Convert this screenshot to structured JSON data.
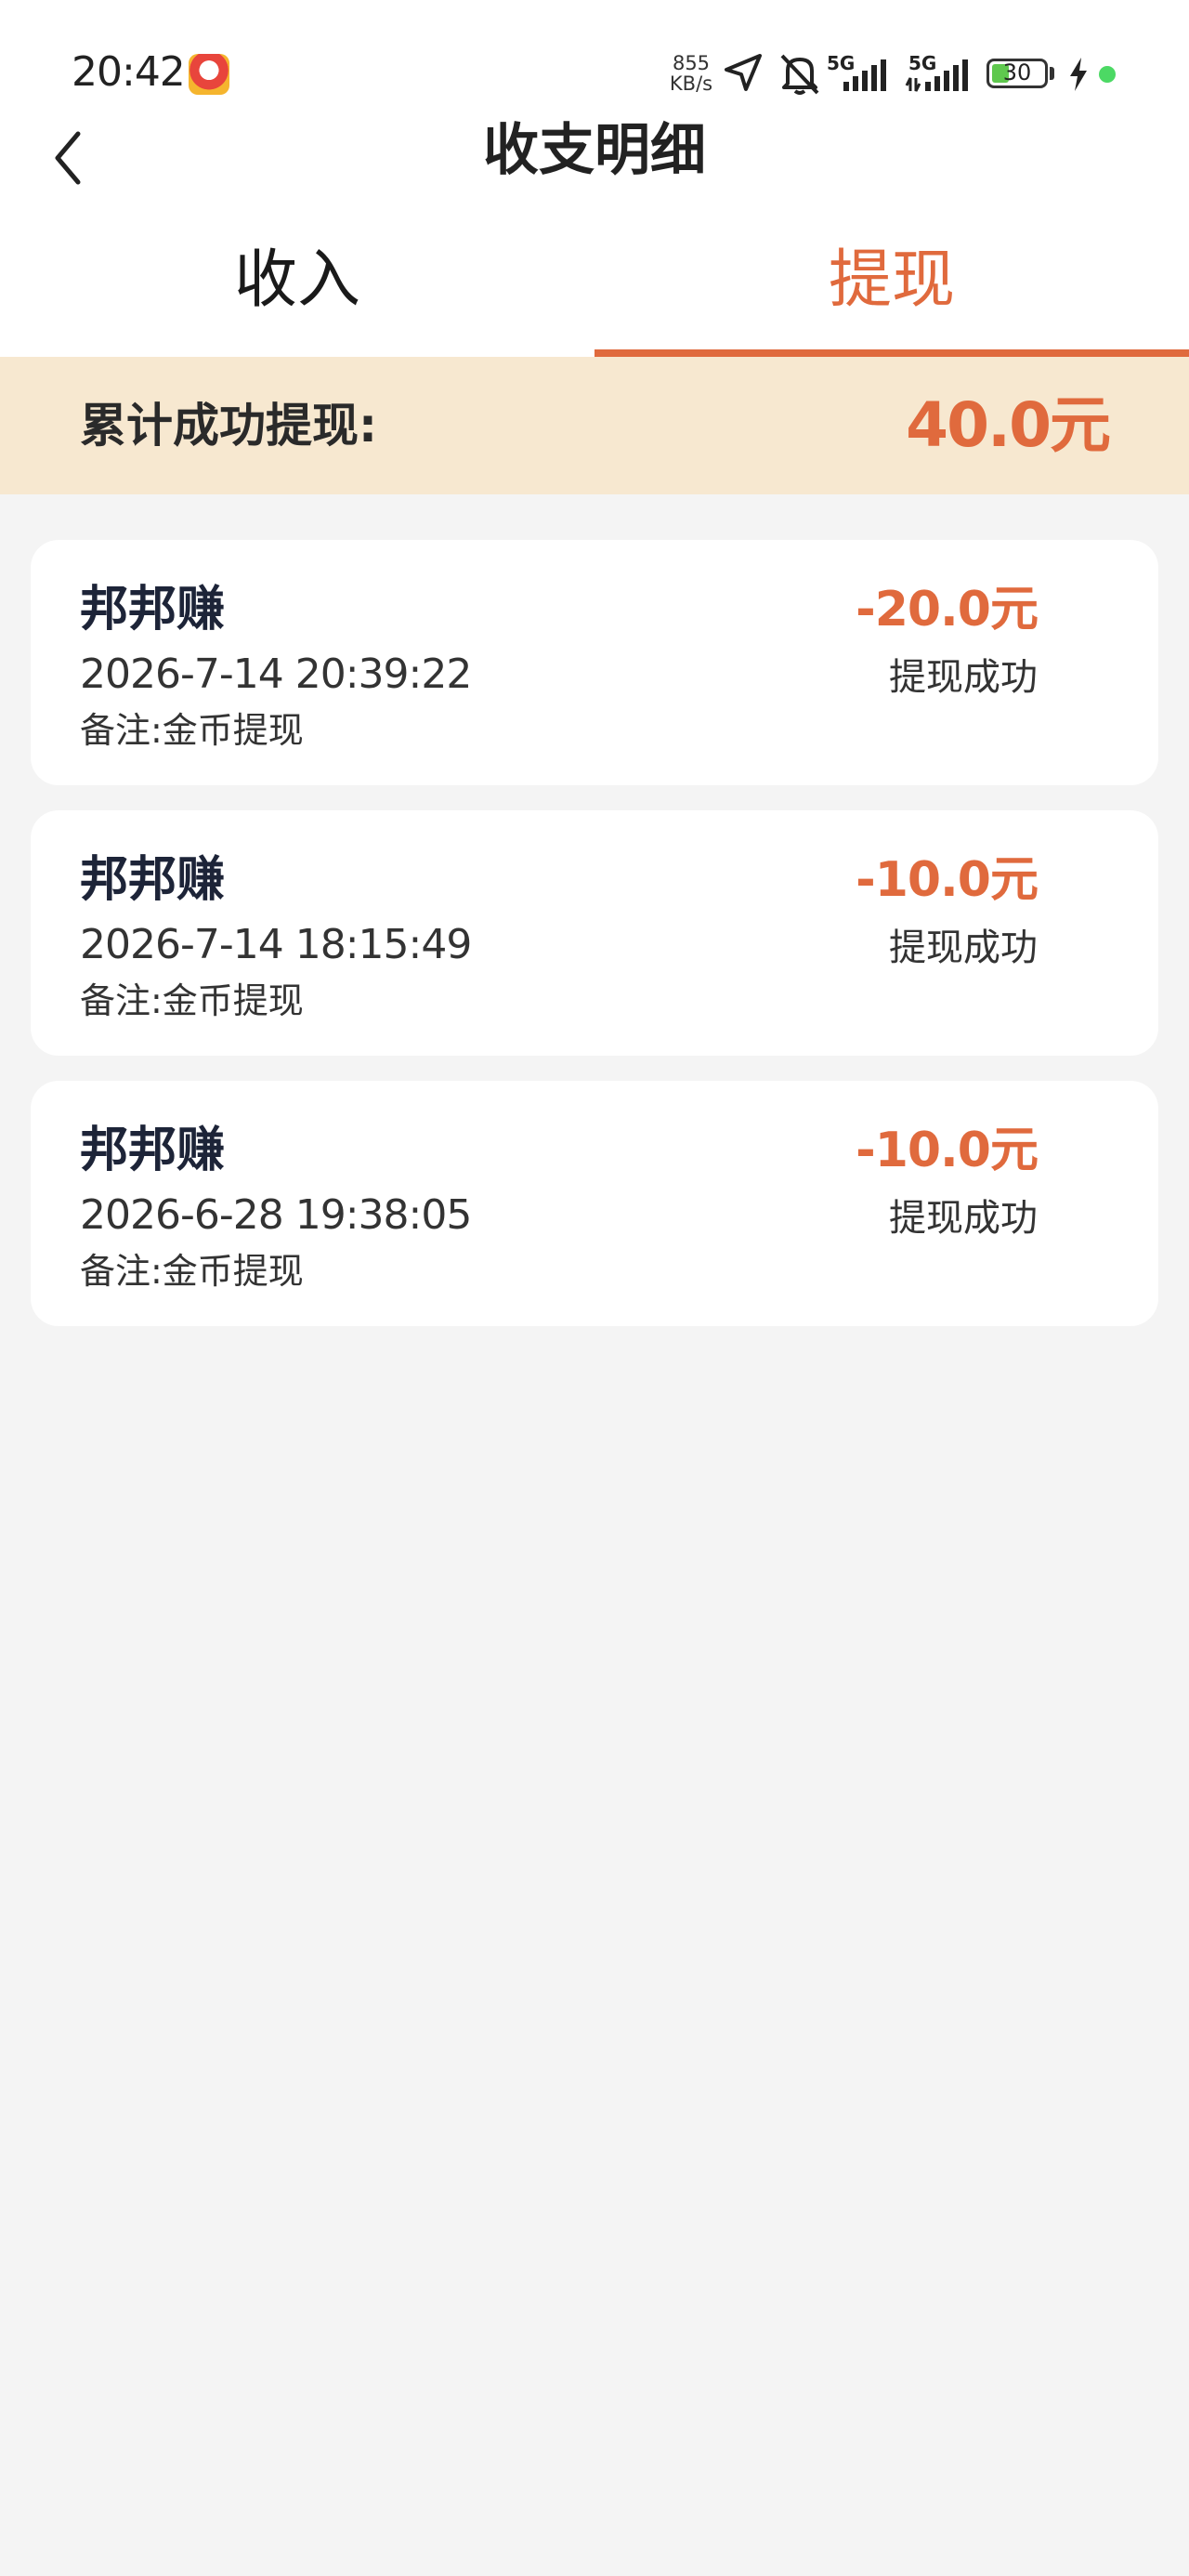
{
  "status_bar": {
    "time": "20:42",
    "net_speed_value": "855",
    "net_speed_unit": "KB/s",
    "signal_1_label": "5G",
    "signal_2_label": "5G",
    "battery_level": "30",
    "icons": [
      "app-notification-icon",
      "location-arrow-icon",
      "bell-muted-icon",
      "signal-icon",
      "signal-icon",
      "battery-icon",
      "charging-icon"
    ]
  },
  "header": {
    "title": "收支明细",
    "back_icon": "chevron-left-icon"
  },
  "tabs": [
    {
      "label": "收入",
      "active": false
    },
    {
      "label": "提现",
      "active": true
    }
  ],
  "summary": {
    "label": "累计成功提现:",
    "amount": "40.0元"
  },
  "records": [
    {
      "name": "邦邦赚",
      "time": "2026-7-14 20:39:22",
      "note": "备注:金币提现",
      "amount": "-20.0元",
      "status": "提现成功"
    },
    {
      "name": "邦邦赚",
      "time": "2026-7-14 18:15:49",
      "note": "备注:金币提现",
      "amount": "-10.0元",
      "status": "提现成功"
    },
    {
      "name": "邦邦赚",
      "time": "2026-6-28 19:38:05",
      "note": "备注:金币提现",
      "amount": "-10.0元",
      "status": "提现成功"
    }
  ],
  "colors": {
    "accent": "#e06a3d",
    "summary_bg": "#f7e8d0",
    "page_bg": "#f4f4f4",
    "card_bg": "#ffffff",
    "name_text": "#1d2438"
  }
}
